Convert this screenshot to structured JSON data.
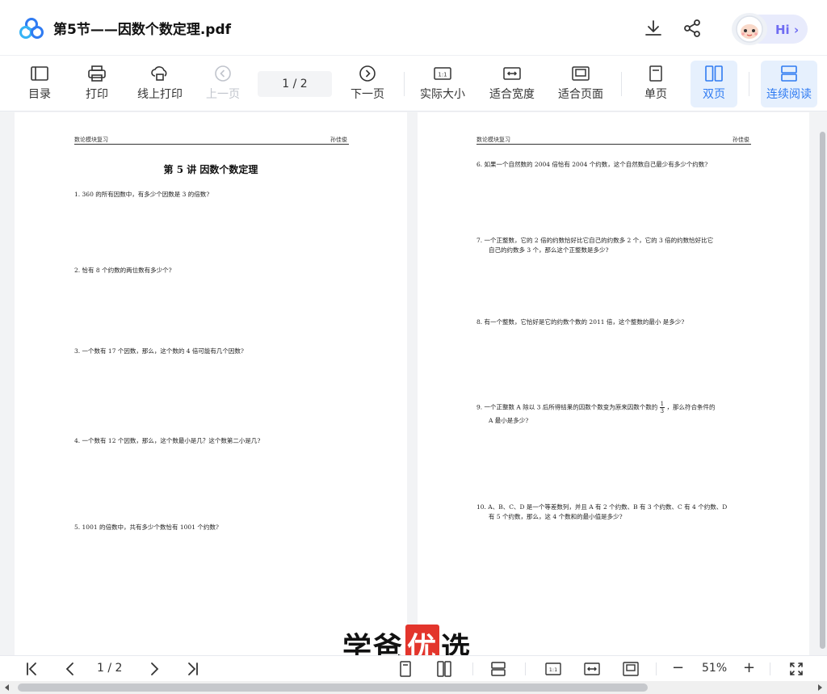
{
  "app": {
    "title": "第5节——因数个数定理.pdf",
    "hi_label": "Hi",
    "hi_chevron": "›",
    "accent": "#2f7bf2"
  },
  "toolbar": {
    "catalog": "目录",
    "print": "打印",
    "online_print": "线上打印",
    "prev_page": "上一页",
    "page_indicator": "1  /  2",
    "next_page": "下一页",
    "actual_size": "实际大小",
    "fit_width": "适合宽度",
    "fit_page": "适合页面",
    "single_page": "单页",
    "double_page": "双页",
    "continuous": "连续阅读"
  },
  "document": {
    "left_page": {
      "header_left": "数论模块复习",
      "header_right": "孙佳俊",
      "title": "第 5 讲    因数个数定理",
      "questions": [
        "1.    360 的所有因数中，有多少个因数是 3 的倍数?",
        "2.    恰有 8 个约数的两位数有多少个?",
        "3.    一个数有 17 个因数，那么，这个数的 4 倍可能有几个因数?",
        "4.    一个数有 12 个因数，那么，这个数最小是几？这个数第二小是几?",
        "5.    1001 的倍数中，共有多少个数恰有 1001 个约数?"
      ]
    },
    "right_page": {
      "header_left": "数论模块复习",
      "header_right": "孙佳俊",
      "q6": "6.    如果一个自然数的 2004 倍恰有 2004 个约数，这个自然数自己最少有多少个约数?",
      "q7_line1": "7.    一个正整数，它的  2 倍的约数恰好比它自己的约数多  2 个，它的  3 倍的约数恰好比它",
      "q7_line2": "自己的约数多 3 个，那么这个正整数是多少?",
      "q8": "8.    有一个整数，它恰好是它的约数个数的 2011 倍，这个整数的最小  是多少?",
      "q9_part1": "9.    一个正整数  A 除以  3 后所得结果的因数个数变为原来因数个数的",
      "q9_frac_num": "1",
      "q9_frac_den": "3",
      "q9_part2": "，那么符合条件的",
      "q9_line2": "A 最小是多少?",
      "q10_line1": "10.  A、B、C、D 是一个等差数列，并且 A 有 2 个约数、B 有 3 个约数、C 有 4 个约数、D",
      "q10_line2": "有 5 个约数，那么，这 4 个数和的最小值是多少?"
    }
  },
  "watermark": {
    "part1": "学爸",
    "highlight": "优",
    "part2": "选",
    "highlight_color": "#e3352c"
  },
  "bottombar": {
    "page_indicator": "1 / 2",
    "zoom": "51%",
    "minus": "−",
    "plus": "+"
  }
}
